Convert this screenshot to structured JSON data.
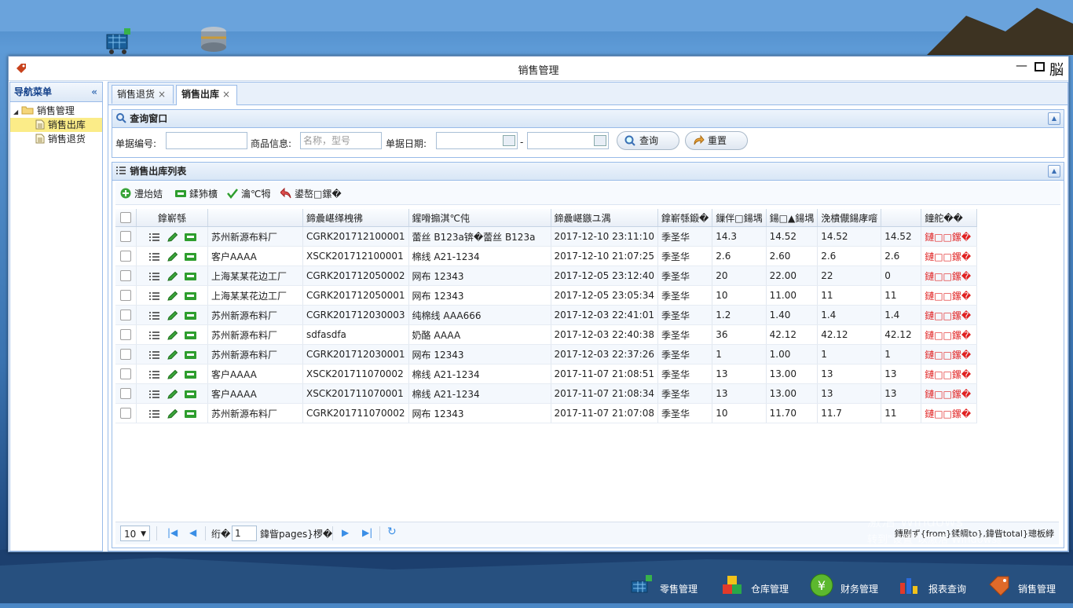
{
  "window": {
    "title": "销售管理",
    "maximize_glyph": "脳"
  },
  "nav": {
    "header": "导航菜单",
    "root": "销售管理",
    "items": [
      {
        "label": "销售出库"
      },
      {
        "label": "销售退货"
      }
    ]
  },
  "tabs": [
    {
      "label": "销售退货"
    },
    {
      "label": "销售出库"
    }
  ],
  "query": {
    "title": "查询窗口",
    "doc_no_label": "单据编号:",
    "goods_label": "商品信息:",
    "goods_placeholder": "名称，型号",
    "date_label": "单据日期:",
    "date_sep": "-",
    "search_btn": "查询",
    "reset_btn": "重置"
  },
  "list": {
    "title": "销售出库列表",
    "toolbar": [
      "澧炲姞",
      "鍒犻櫎",
      "瀹℃牳",
      "鍙嶅□鏍�"
    ],
    "headers": [
      "鎿嶄綔",
      "",
      "鍗曟嵁缂栧彿",
      "鍟嗗搧淇℃伅",
      "鍗曟嵁鏃ユ湡",
      "鎿嶄綔鍛�",
      "鏁伴□鍚堣",
      "鍚□▲鍚堣",
      "浼樻儬鍚庨噾",
      "",
      "鐘舵��"
    ],
    "rows": [
      {
        "customer": "苏州新源布料厂",
        "no": "CGRK201712100001",
        "goods": "蕾丝 B123a锛�蕾丝 B123a",
        "date": "2017-12-10 23:11:10",
        "op": "季圣华",
        "qty": "14.3",
        "total": "14.52",
        "disc": "14.52",
        "paid": "14.52",
        "status": "鏈□□鏍�"
      },
      {
        "customer": "客户AAAA",
        "no": "XSCK201712100001",
        "goods": "棉线 A21-1234",
        "date": "2017-12-10 21:07:25",
        "op": "季圣华",
        "qty": "2.6",
        "total": "2.60",
        "disc": "2.6",
        "paid": "2.6",
        "status": "鏈□□鏍�"
      },
      {
        "customer": "上海某某花边工厂",
        "no": "CGRK201712050002",
        "goods": "网布 12343",
        "date": "2017-12-05 23:12:40",
        "op": "季圣华",
        "qty": "20",
        "total": "22.00",
        "disc": "22",
        "paid": "0",
        "status": "鏈□□鏍�"
      },
      {
        "customer": "上海某某花边工厂",
        "no": "CGRK201712050001",
        "goods": "网布 12343",
        "date": "2017-12-05 23:05:34",
        "op": "季圣华",
        "qty": "10",
        "total": "11.00",
        "disc": "11",
        "paid": "11",
        "status": "鏈□□鏍�"
      },
      {
        "customer": "苏州新源布料厂",
        "no": "CGRK201712030003",
        "goods": "纯棉线 AAA666",
        "date": "2017-12-03 22:41:01",
        "op": "季圣华",
        "qty": "1.2",
        "total": "1.40",
        "disc": "1.4",
        "paid": "1.4",
        "status": "鏈□□鏍�"
      },
      {
        "customer": "苏州新源布料厂",
        "no": "sdfasdfa",
        "goods": "奶酪 AAAA",
        "date": "2017-12-03 22:40:38",
        "op": "季圣华",
        "qty": "36",
        "total": "42.12",
        "disc": "42.12",
        "paid": "42.12",
        "status": "鏈□□鏍�"
      },
      {
        "customer": "苏州新源布料厂",
        "no": "CGRK201712030001",
        "goods": "网布 12343",
        "date": "2017-12-03 22:37:26",
        "op": "季圣华",
        "qty": "1",
        "total": "1.00",
        "disc": "1",
        "paid": "1",
        "status": "鏈□□鏍�"
      },
      {
        "customer": "客户AAAA",
        "no": "XSCK201711070002",
        "goods": "棉线 A21-1234",
        "date": "2017-11-07 21:08:51",
        "op": "季圣华",
        "qty": "13",
        "total": "13.00",
        "disc": "13",
        "paid": "13",
        "status": "鏈□□鏍�"
      },
      {
        "customer": "客户AAAA",
        "no": "XSCK201711070001",
        "goods": "棉线 A21-1234",
        "date": "2017-11-07 21:08:34",
        "op": "季圣华",
        "qty": "13",
        "total": "13.00",
        "disc": "13",
        "paid": "13",
        "status": "鏈□□鏍�"
      },
      {
        "customer": "苏州新源布料厂",
        "no": "CGRK201711070002",
        "goods": "网布 12343",
        "date": "2017-11-07 21:07:08",
        "op": "季圣华",
        "qty": "10",
        "total": "11.70",
        "disc": "11.7",
        "paid": "11",
        "status": "鏈□□鏍�"
      }
    ],
    "pager": {
      "page_size": "10",
      "page_prefix": "绗�",
      "page_value": "1",
      "page_suffix": "鍏眥pages}椤�",
      "info": "鏄剧ず{from}鍒皗to},鍏眥total}璁板綍"
    }
  },
  "taskbar": [
    {
      "label": "零售管理"
    },
    {
      "label": "仓库管理"
    },
    {
      "label": "财务管理"
    },
    {
      "label": "报表查询"
    },
    {
      "label": "销售管理"
    }
  ],
  "watermark": {
    "line1": "激活 Windows",
    "line2": "转到\"设置\"以激活 Windows。"
  },
  "colors": {
    "accent": "#99bbe8",
    "status_red": "#e02020",
    "selected_tree": "#fbec88"
  }
}
